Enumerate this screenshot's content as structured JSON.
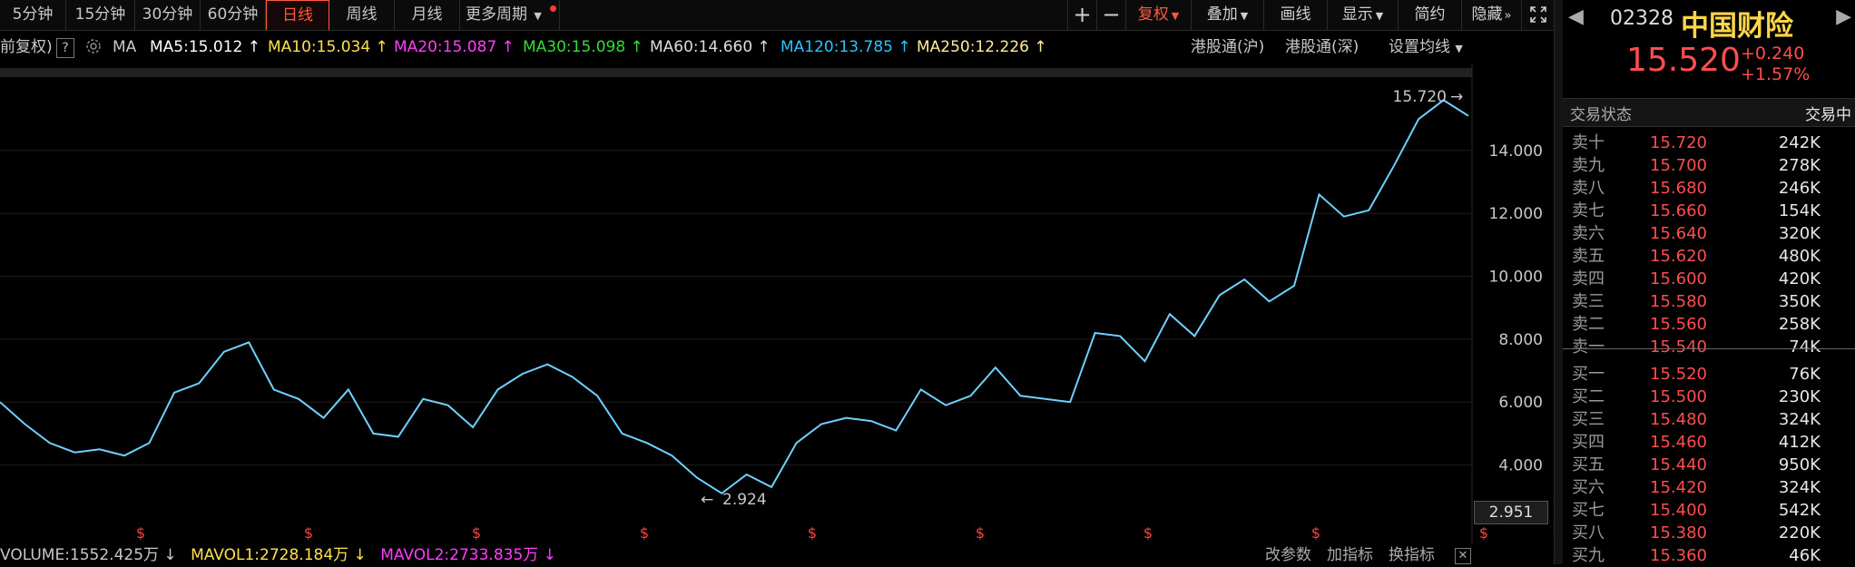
{
  "periods": [
    {
      "label": "5分钟",
      "active": false
    },
    {
      "label": "15分钟",
      "active": false
    },
    {
      "label": "30分钟",
      "active": false
    },
    {
      "label": "60分钟",
      "active": false
    },
    {
      "label": "日线",
      "active": true
    },
    {
      "label": "周线",
      "active": false
    },
    {
      "label": "月线",
      "active": false
    },
    {
      "label": "更多周期",
      "active": false
    }
  ],
  "toolbar": {
    "plus": "+",
    "minus": "−",
    "fuquan": "复权",
    "diejia": "叠加",
    "huaxian": "画线",
    "xianshi": "显示",
    "jianyue": "简约",
    "yincang": "隐藏",
    "expand_icon": "expand-icon"
  },
  "ma_bar": {
    "adj": "前复权)",
    "help": "?",
    "ma": "MA",
    "items": [
      {
        "text": "MA5:15.012",
        "color": "#ffffff"
      },
      {
        "text": "MA10:15.034",
        "color": "#ffe14d"
      },
      {
        "text": "MA20:15.087",
        "color": "#ff3dff"
      },
      {
        "text": "MA30:15.098",
        "color": "#33dd33"
      },
      {
        "text": "MA60:14.660",
        "color": "#dddddd"
      },
      {
        "text": "MA120:13.785",
        "color": "#26c6ff"
      },
      {
        "text": "MA250:12.226",
        "color": "#ffee99"
      }
    ],
    "hk_sh": "港股通(沪)",
    "hk_sz": "港股通(深)",
    "settings": "设置均线"
  },
  "chart_data": {
    "type": "line",
    "y_ticks": [
      4.0,
      6.0,
      8.0,
      10.0,
      12.0,
      14.0
    ],
    "y_tick_labels": [
      "4.000",
      "6.000",
      "8.000",
      "10.000",
      "12.000",
      "14.000"
    ],
    "ylim": [
      2.2,
      15.9
    ],
    "high": {
      "value": 15.72,
      "label": "15.720"
    },
    "low": {
      "value": 2.924,
      "label": "2.924"
    },
    "current_price_tag": "2.951",
    "event_marker": "$",
    "event_count": 11,
    "series": [
      {
        "color": "#6fd1ff",
        "values": [
          6.0,
          5.3,
          4.7,
          4.4,
          4.5,
          4.3,
          4.7,
          6.3,
          6.6,
          7.6,
          7.9,
          6.4,
          6.1,
          5.5,
          6.4,
          5.0,
          4.9,
          6.1,
          5.9,
          5.2,
          6.4,
          6.9,
          7.2,
          6.8,
          6.2,
          5.0,
          4.7,
          4.3,
          3.6,
          3.1,
          3.7,
          3.3,
          4.7,
          5.3,
          5.5,
          5.4,
          5.1,
          6.4,
          5.9,
          6.2,
          7.1,
          6.2,
          6.1,
          6.0,
          8.2,
          8.1,
          7.3,
          8.8,
          8.1,
          9.4,
          9.9,
          9.2,
          9.7,
          12.6,
          11.9,
          12.1,
          13.5,
          15.0,
          15.6,
          15.1
        ]
      }
    ]
  },
  "volume_bar": {
    "volume": "VOLUME:1552.425万",
    "mavol1": "MAVOL1:2728.184万",
    "mavol2": "MAVOL2:2733.835万",
    "change_params": "改参数",
    "add_indicator": "加指标",
    "switch_indicator": "换指标"
  },
  "quote": {
    "code": "02328",
    "name": "中国财险",
    "price": "15.520",
    "change": "+0.240",
    "change_pct": "+1.57%",
    "status_label": "交易状态",
    "status_value": "交易中"
  },
  "order_book": [
    {
      "label": "卖十",
      "price": "15.720",
      "vol": "242K"
    },
    {
      "label": "卖九",
      "price": "15.700",
      "vol": "278K"
    },
    {
      "label": "卖八",
      "price": "15.680",
      "vol": "246K"
    },
    {
      "label": "卖七",
      "price": "15.660",
      "vol": "154K"
    },
    {
      "label": "卖六",
      "price": "15.640",
      "vol": "320K"
    },
    {
      "label": "卖五",
      "price": "15.620",
      "vol": "480K"
    },
    {
      "label": "卖四",
      "price": "15.600",
      "vol": "420K"
    },
    {
      "label": "卖三",
      "price": "15.580",
      "vol": "350K"
    },
    {
      "label": "卖二",
      "price": "15.560",
      "vol": "258K"
    },
    {
      "label": "卖一",
      "price": "15.540",
      "vol": "74K"
    },
    {
      "label": "买一",
      "price": "15.520",
      "vol": "76K"
    },
    {
      "label": "买二",
      "price": "15.500",
      "vol": "230K"
    },
    {
      "label": "买三",
      "price": "15.480",
      "vol": "324K"
    },
    {
      "label": "买四",
      "price": "15.460",
      "vol": "412K"
    },
    {
      "label": "买五",
      "price": "15.440",
      "vol": "950K"
    },
    {
      "label": "买六",
      "price": "15.420",
      "vol": "324K"
    },
    {
      "label": "买七",
      "price": "15.400",
      "vol": "542K"
    },
    {
      "label": "买八",
      "price": "15.380",
      "vol": "220K"
    },
    {
      "label": "买九",
      "price": "15.360",
      "vol": "46K"
    }
  ],
  "colors": {
    "up": "#ff4d4d",
    "accent": "#ff5a3c",
    "name": "#ffd54a"
  }
}
